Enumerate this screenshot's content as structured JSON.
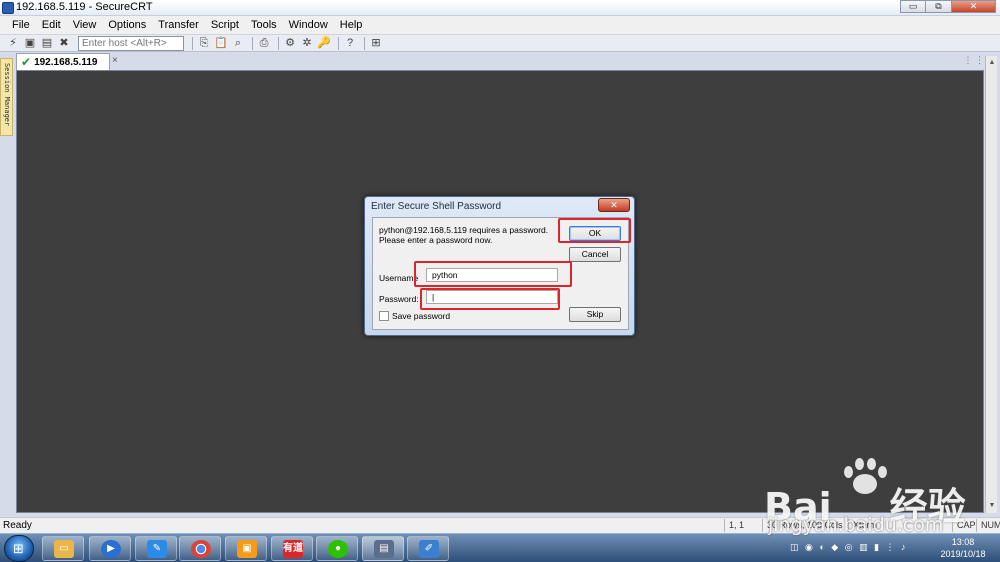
{
  "window": {
    "title": "192.168.5.119 - SecureCRT",
    "minimize": "▭",
    "restore": "⧉",
    "close": "✕"
  },
  "menu": [
    "File",
    "Edit",
    "View",
    "Options",
    "Transfer",
    "Script",
    "Tools",
    "Window",
    "Help"
  ],
  "toolbar": {
    "host_placeholder": "Enter host <Alt+R>"
  },
  "session_manager": {
    "label": "Session Manager"
  },
  "tab": {
    "label": "192.168.5.119",
    "close": "×",
    "status": "connected"
  },
  "dialog": {
    "title": "Enter Secure Shell Password",
    "close": "✕",
    "message_line1": "python@192.168.5.119 requires a password.",
    "message_line2": "Please enter a password now.",
    "ok": "OK",
    "cancel": "Cancel",
    "skip": "Skip",
    "username_label": "Username",
    "username_value": "python",
    "password_label": "Password:",
    "password_value": "|",
    "save_password_label": "Save password",
    "save_password_checked": false
  },
  "statusbar": {
    "ready": "Ready",
    "position": "1,   1",
    "rows_cols": "30 Rows, 109 Cols",
    "terminal": "Xterm",
    "cap": "CAP",
    "num": "NUM"
  },
  "taskbar": {
    "time": "13:08",
    "date": "2019/10/18",
    "apps": [
      "file-explorer",
      "media-player",
      "note-app",
      "chrome",
      "vmware",
      "youdao",
      "wechat",
      "securecrt",
      "paint"
    ],
    "youdao_label": "有道"
  },
  "watermark": {
    "brand": "Bai",
    "brand_suffix": "经验",
    "url": "jingyan.baidu.com"
  },
  "colors": {
    "highlight": "#e0242b",
    "terminal_bg": "#3e3e3e",
    "taskbar": "#2d4e78"
  }
}
